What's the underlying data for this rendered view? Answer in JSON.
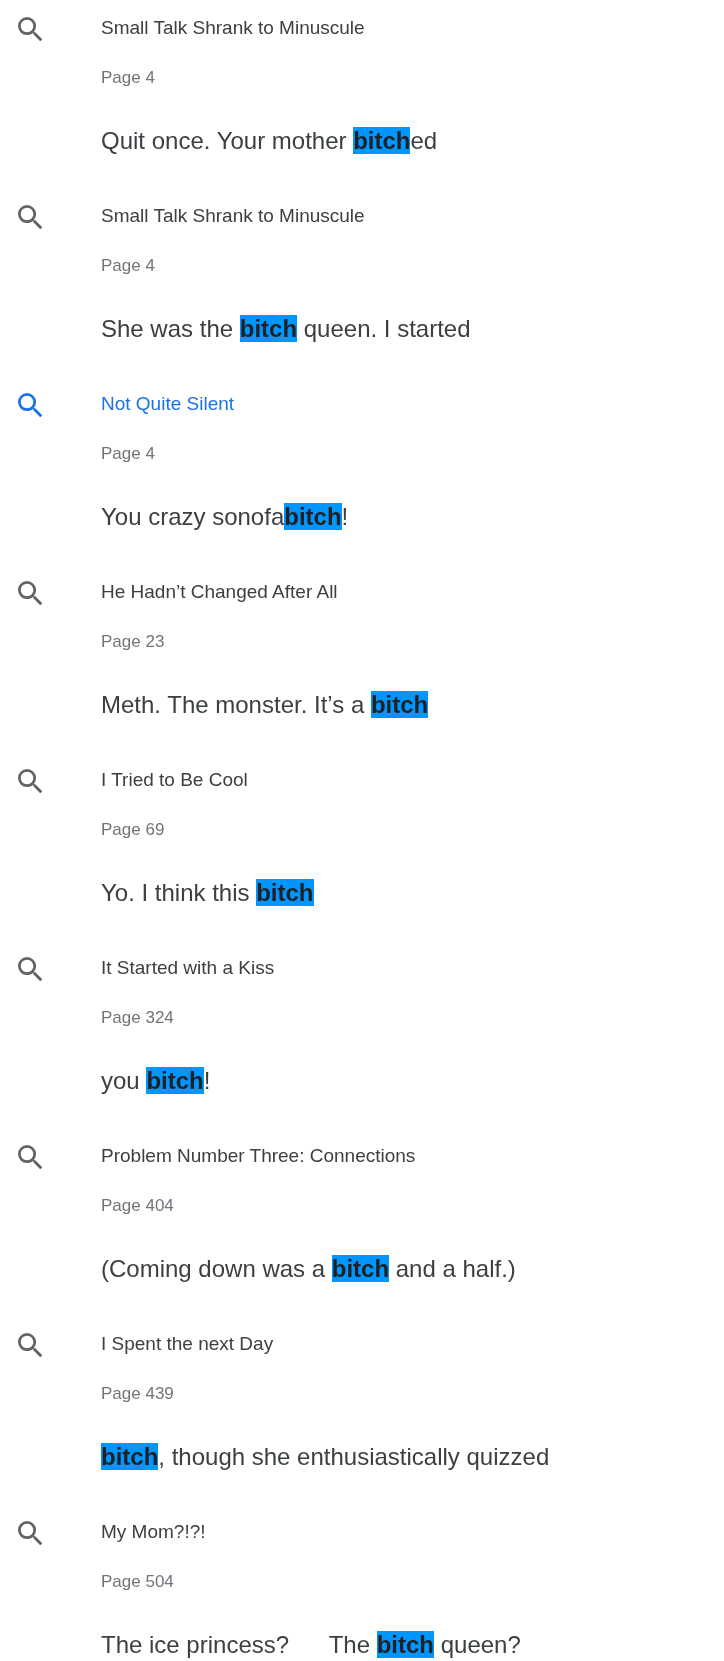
{
  "results": [
    {
      "title": "Small Talk Shrank to Minuscule",
      "page": "Page 4",
      "selected": false,
      "snippet": [
        {
          "text": "Quit once. Your mother ",
          "match": false
        },
        {
          "text": "bitch",
          "match": true
        },
        {
          "text": "ed",
          "match": false
        }
      ]
    },
    {
      "title": "Small Talk Shrank to Minuscule",
      "page": "Page 4",
      "selected": false,
      "snippet": [
        {
          "text": "She was the ",
          "match": false
        },
        {
          "text": "bitch",
          "match": true
        },
        {
          "text": " queen. I started",
          "match": false
        }
      ]
    },
    {
      "title": "Not Quite Silent",
      "page": "Page 4",
      "selected": true,
      "snippet": [
        {
          "text": "You crazy sonofa",
          "match": false
        },
        {
          "text": "bitch",
          "match": true
        },
        {
          "text": "!",
          "match": false
        }
      ]
    },
    {
      "title": "He Hadn’t Changed After All",
      "page": "Page 23",
      "selected": false,
      "snippet": [
        {
          "text": "Meth. The monster. It’s a ",
          "match": false
        },
        {
          "text": "bitch",
          "match": true
        }
      ]
    },
    {
      "title": "I Tried to Be Cool",
      "page": "Page 69",
      "selected": false,
      "snippet": [
        {
          "text": "Yo. I think this ",
          "match": false
        },
        {
          "text": "bitch",
          "match": true
        }
      ]
    },
    {
      "title": "It Started with a Kiss",
      "page": "Page 324",
      "selected": false,
      "snippet": [
        {
          "text": "you ",
          "match": false
        },
        {
          "text": "bitch",
          "match": true
        },
        {
          "text": "!",
          "match": false
        }
      ]
    },
    {
      "title": "Problem Number Three: Connections",
      "page": "Page 404",
      "selected": false,
      "snippet": [
        {
          "text": "(Coming down was a ",
          "match": false
        },
        {
          "text": "bitch",
          "match": true
        },
        {
          "text": " and a half.)",
          "match": false
        }
      ]
    },
    {
      "title": "I Spent the next Day",
      "page": "Page 439",
      "selected": false,
      "snippet": [
        {
          "text": "bitch",
          "match": true
        },
        {
          "text": ", though she enthusiastically quizzed",
          "match": false
        }
      ]
    },
    {
      "title": "My Mom?!?!",
      "page": "Page 504",
      "selected": false,
      "snippet": [
        {
          "text": "The ice princess?      The ",
          "match": false
        },
        {
          "text": "bitch",
          "match": true
        },
        {
          "text": " queen?",
          "match": false
        }
      ]
    }
  ]
}
